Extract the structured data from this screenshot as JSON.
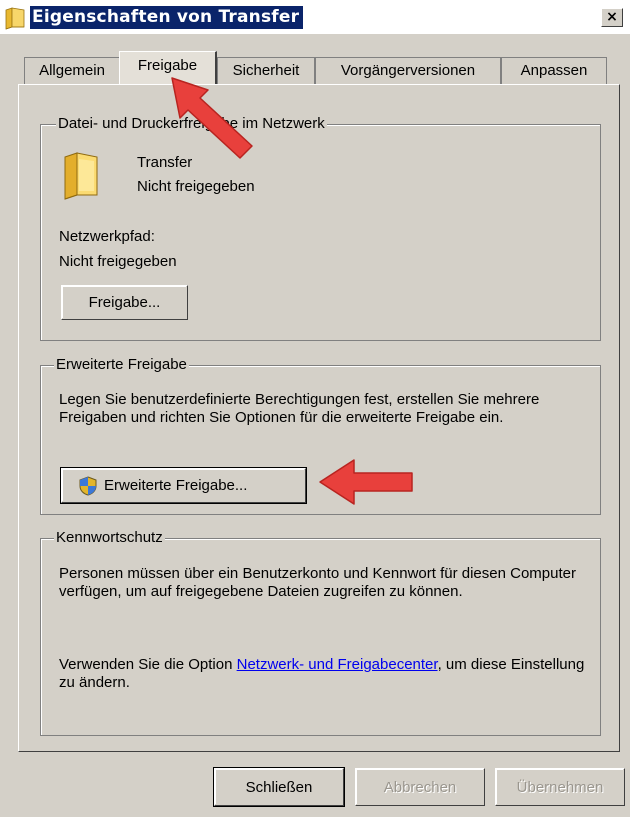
{
  "window": {
    "title": "Eigenschaften von Transfer",
    "close_label": "×"
  },
  "tabs": [
    {
      "label": "Allgemein"
    },
    {
      "label": "Freigabe"
    },
    {
      "label": "Sicherheit"
    },
    {
      "label": "Vorgängerversionen"
    },
    {
      "label": "Anpassen"
    }
  ],
  "active_tab": "Freigabe",
  "network_sharing": {
    "legend": "Datei- und Druckerfreigabe im Netzwerk",
    "folder_name": "Transfer",
    "status": "Nicht freigegeben",
    "path_label": "Netzwerkpfad:",
    "path_value": "Nicht freigegeben",
    "share_button": "Freigabe..."
  },
  "advanced_sharing": {
    "legend": "Erweiterte Freigabe",
    "description": "Legen Sie benutzerdefinierte Berechtigungen fest, erstellen Sie mehrere Freigaben und richten Sie Optionen für die erweiterte Freigabe ein.",
    "button": "Erweiterte Freigabe..."
  },
  "password_protection": {
    "legend": "Kennwortschutz",
    "description": "Personen müssen über ein Benutzerkonto und Kennwort für diesen Computer verfügen, um auf freigegebene Dateien zugreifen zu können.",
    "text_before_link": "Verwenden Sie die Option ",
    "link": "Netzwerk- und Freigabecenter",
    "text_after_link": ", um diese Einstellung zu ändern."
  },
  "footer": {
    "close_button": "Schließen",
    "cancel_button": "Abbrechen",
    "apply_button": "Übernehmen"
  },
  "colors": {
    "annotation_arrow": "#e8403c",
    "title_highlight": "#0a246a",
    "dialog_face": "#d4d0c8"
  }
}
